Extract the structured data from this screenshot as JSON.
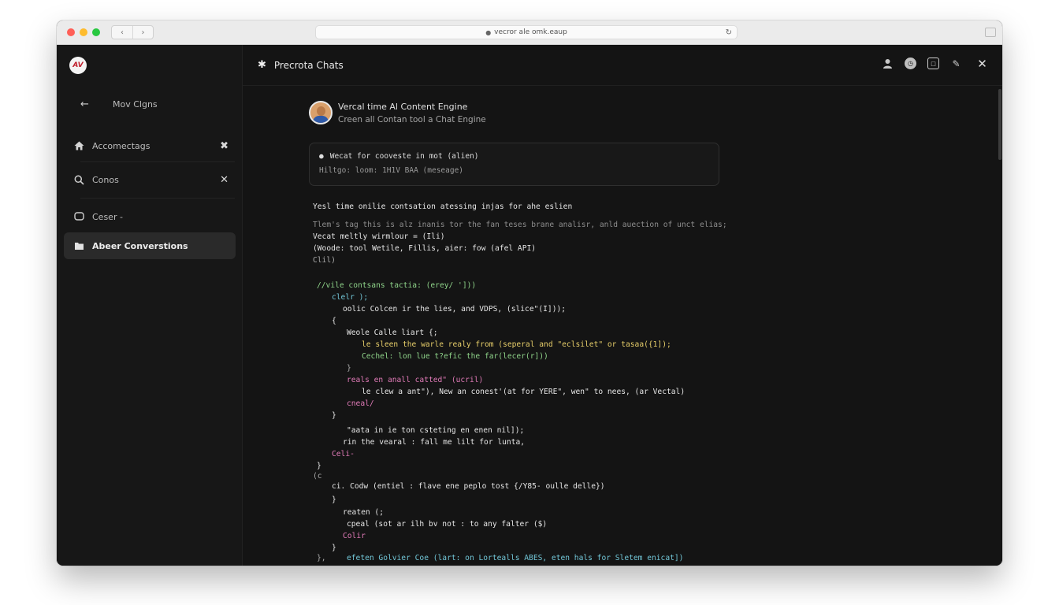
{
  "browser": {
    "address": "vecror ale omk.eaup",
    "nav_back": "‹",
    "nav_forward": "›"
  },
  "sidebar": {
    "logo_text": "AV",
    "back_label": "Mov Clgns",
    "items": [
      {
        "label": "Accomectags",
        "icon": "home-icon",
        "closable": true
      },
      {
        "label": "Conos",
        "icon": "search-icon",
        "closable": true
      },
      {
        "label": "Ceser -",
        "icon": "chat-icon",
        "closable": false
      },
      {
        "label": "Abeer Converstions",
        "icon": "folder-icon",
        "closable": false,
        "active": true
      }
    ]
  },
  "topbar": {
    "title": "Precrota Chats",
    "actions": [
      "user-icon",
      "history-icon",
      "share-icon",
      "edit-icon",
      "close-icon"
    ]
  },
  "chat": {
    "title": "Vercal time Al Content Engine",
    "subtitle": "Creen all Contan tool a Chat Engine",
    "prompt_line1": "Wecat for cooveste in mot (alien)",
    "prompt_line2": "Hiltgo: loom: 1H1V BAA (meseage)"
  },
  "code": {
    "intro": "Yesl time onilie contsation atessing injas for ahe eslien",
    "lines": [
      "Tlem's tag this is alz inanis tor the fan teses brane analisr, anld auection of unct elias;",
      "Vecat meltly wirmlour = (Ili)",
      "(Woode: tool Wetile, Fillis, aier: fow (afel API)",
      "Clil)",
      "//vile contsans tactia: (erey/ ']))",
      "clelr );",
      "oolic Colcen ir the lies, and VDPS, (slice\"(I]));",
      "{",
      "Weole Calle liart {;",
      "le sleen the warle realy from (seperal and \"eclsilet\" or tasaa({1]);",
      "Cechel: lon lue t?efic the far(lecer(r]))",
      "}",
      "reals en anall catted\" (ucril)",
      "le clew a ant\"), New an conest'(at for YERE\", wen\" to nees, (ar Vectal)",
      "cneal/",
      "}",
      "\"aata in ie ton csteting en enen nil]);",
      "rin the vearal : fall me lilt for lunta,",
      "Celi-",
      "}",
      "(c",
      "ci. Codw (entiel : flave ene peplo tost {/Y85- oulle delle})",
      "}",
      "reaten (;",
      "cpeal (sot ar ilh bv not : to any falter ($)",
      "Colir",
      "}",
      "},",
      "efeten Golvier Coe (lart: on Lortealls ABES, eten hals for Sletem enicat])"
    ]
  },
  "colors": {
    "window_bg": "#141414",
    "sidebar_bg": "#171717",
    "active_item_bg": "#2a2a2a",
    "accent_red": "#ef6a6a",
    "accent_cyan": "#72c7d8",
    "accent_green": "#8fd48a",
    "accent_yellow": "#e8cf6a",
    "accent_pink": "#e07ab7"
  }
}
